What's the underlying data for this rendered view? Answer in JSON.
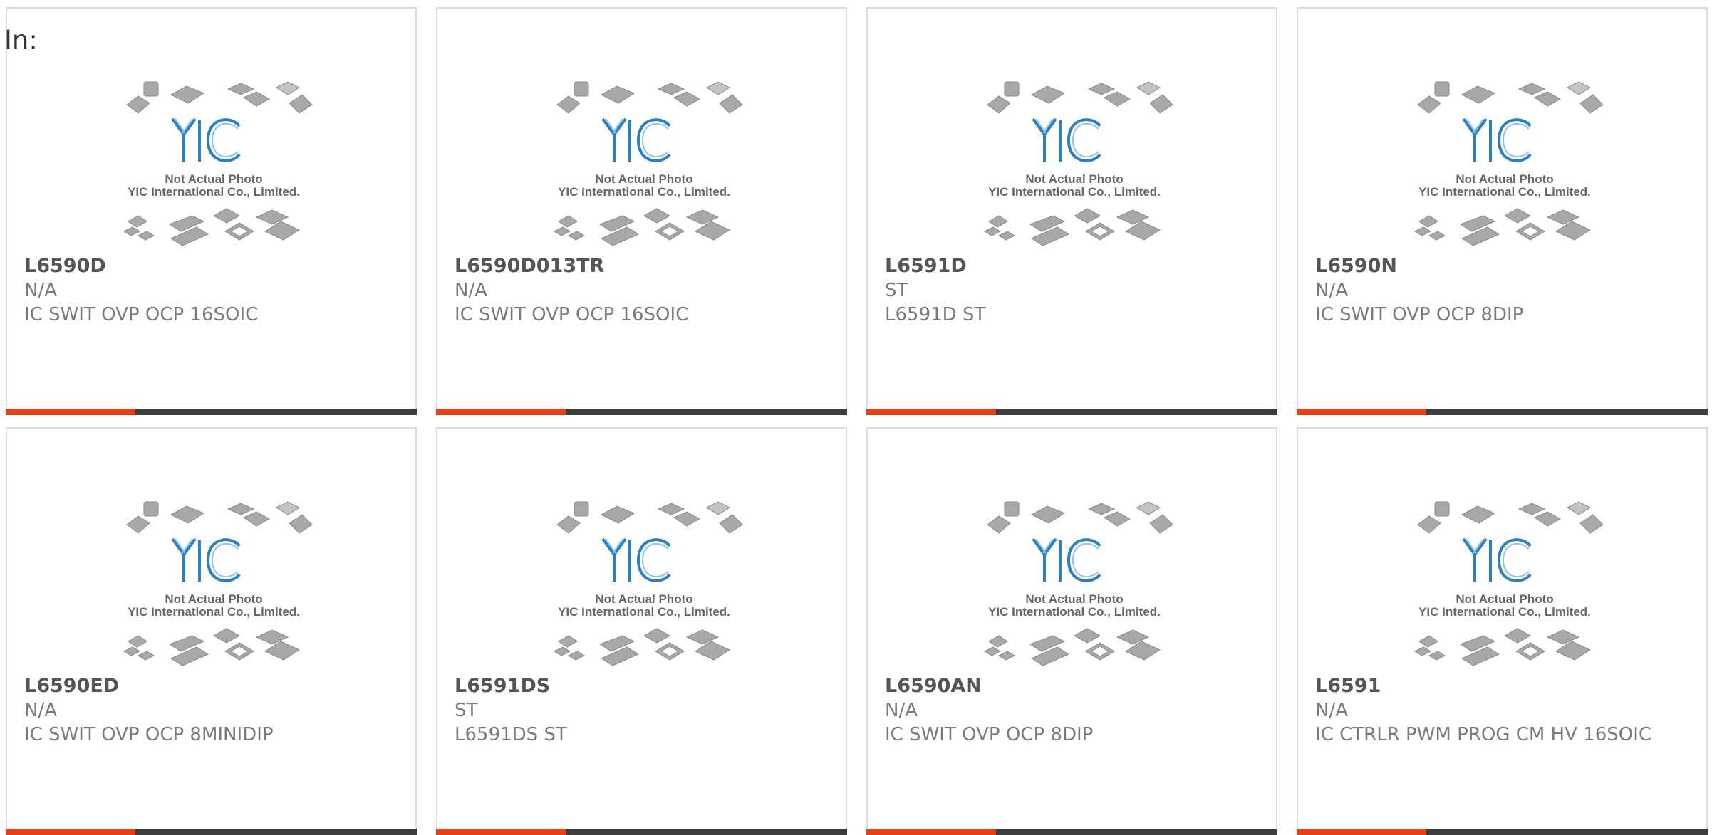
{
  "page": {
    "label": "In:"
  },
  "colors": {
    "accent_bar": "#e6401a",
    "dark_bar": "#3d3d3d",
    "logo_blue": "#2b7fc2"
  },
  "placeholder_image": {
    "icon": "chip-packages-placeholder-icon",
    "logo_text": "YIC",
    "caption_line1": "Not Actual Photo",
    "caption_line2": "YIC International Co., Limited."
  },
  "products": [
    {
      "part_number": "L6590D",
      "manufacturer": "N/A",
      "description": "IC SWIT OVP OCP 16SOIC"
    },
    {
      "part_number": "L6590D013TR",
      "manufacturer": "N/A",
      "description": "IC SWIT OVP OCP 16SOIC"
    },
    {
      "part_number": "L6591D",
      "manufacturer": "ST",
      "description": "L6591D ST"
    },
    {
      "part_number": "L6590N",
      "manufacturer": "N/A",
      "description": "IC SWIT OVP OCP 8DIP"
    },
    {
      "part_number": "L6590ED",
      "manufacturer": "N/A",
      "description": "IC SWIT OVP OCP 8MINIDIP"
    },
    {
      "part_number": "L6591DS",
      "manufacturer": "ST",
      "description": "L6591DS ST"
    },
    {
      "part_number": "L6590AN",
      "manufacturer": "N/A",
      "description": "IC SWIT OVP OCP 8DIP"
    },
    {
      "part_number": "L6591",
      "manufacturer": "N/A",
      "description": "IC CTRLR PWM PROG CM HV 16SOIC"
    }
  ]
}
